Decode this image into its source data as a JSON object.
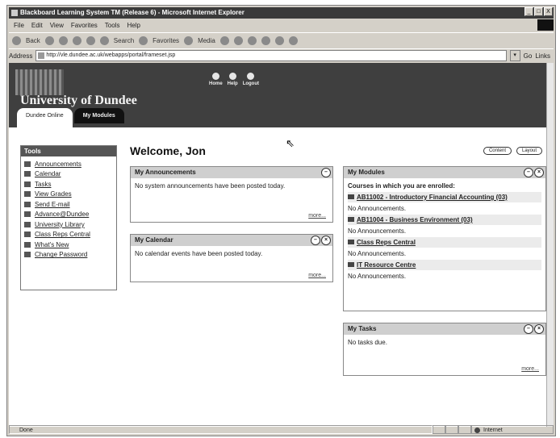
{
  "window": {
    "title": "Blackboard Learning System TM (Release 6) - Microsoft Internet Explorer",
    "controls": [
      "_",
      "□",
      "X"
    ]
  },
  "menubar": [
    "File",
    "Edit",
    "View",
    "Favorites",
    "Tools",
    "Help"
  ],
  "toolbar": {
    "back": "Back",
    "search": "Search",
    "favorites": "Favorites",
    "media": "Media"
  },
  "address": {
    "label": "Address",
    "url": "http://vle.dundee.ac.uk/webapps/portal/frameset.jsp",
    "go": "Go",
    "links": "Links"
  },
  "banner": {
    "university_name": "University of Dundee",
    "nav": [
      "Home",
      "Help",
      "Logout"
    ]
  },
  "tabs": [
    "Dundee Online",
    "My Modules"
  ],
  "tools": {
    "header": "Tools",
    "items": [
      "Announcements",
      "Calendar",
      "Tasks",
      "View Grades",
      "Send E-mail",
      "Advance@Dundee",
      "University Library",
      "Class Reps Central",
      "What's New",
      "Change Password"
    ]
  },
  "welcome": "Welcome, Jon",
  "buttons": {
    "content": "Content",
    "layout": "Layout"
  },
  "announcements": {
    "title": "My Announcements",
    "text": "No system announcements have been posted today.",
    "more": "more..."
  },
  "calendar": {
    "title": "My Calendar",
    "text": "No calendar events have been posted today.",
    "more": "more..."
  },
  "modules": {
    "title": "My Modules",
    "intro": "Courses in which you are enrolled:",
    "courses": [
      {
        "name": "AB11002 - Introductory Financial Accounting (03)",
        "note": "No Announcements."
      },
      {
        "name": "AB11004 - Business Environment (03)",
        "note": "No Announcements."
      },
      {
        "name": "Class Reps Central",
        "note": "No Announcements."
      },
      {
        "name": "IT Resource Centre",
        "note": "No Announcements."
      }
    ]
  },
  "tasks": {
    "title": "My Tasks",
    "text": "No tasks due.",
    "more": "more..."
  },
  "status": {
    "left": "Done",
    "zone": "Internet"
  }
}
